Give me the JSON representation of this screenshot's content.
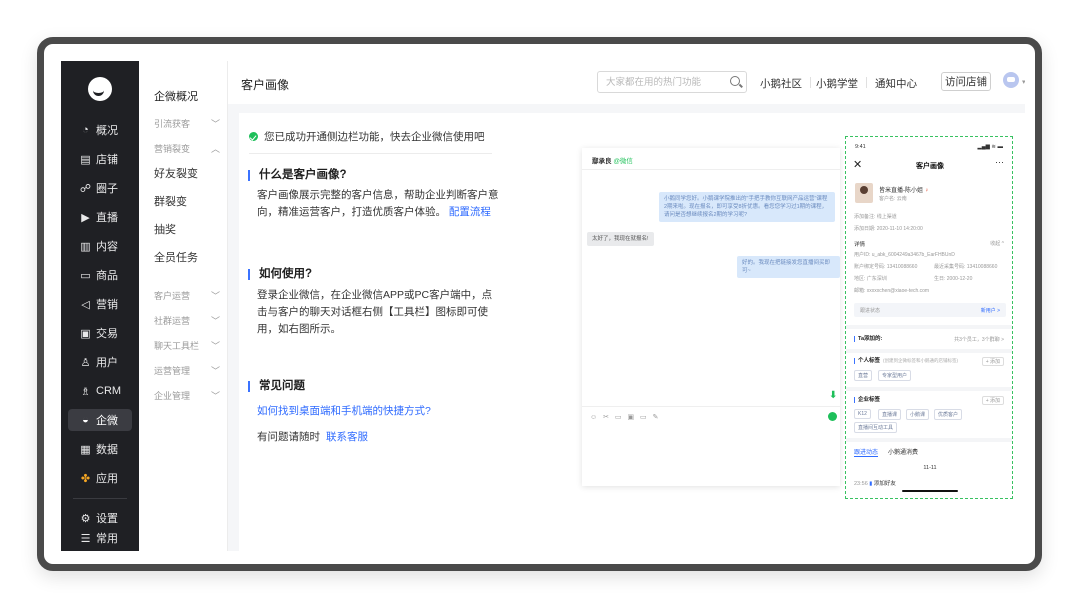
{
  "nav": {
    "items": [
      {
        "label": "概况",
        "icon": "clock-icon",
        "glyph": "◔"
      },
      {
        "label": "店铺",
        "icon": "store-icon",
        "glyph": "▤"
      },
      {
        "label": "圈子",
        "icon": "circle-group-icon",
        "glyph": "☍"
      },
      {
        "label": "直播",
        "icon": "live-icon",
        "glyph": "▶"
      },
      {
        "label": "内容",
        "icon": "document-icon",
        "glyph": "▥"
      },
      {
        "label": "商品",
        "icon": "product-icon",
        "glyph": "▭"
      },
      {
        "label": "营销",
        "icon": "marketing-icon",
        "glyph": "◁"
      },
      {
        "label": "交易",
        "icon": "trade-icon",
        "glyph": "▣"
      },
      {
        "label": "用户",
        "icon": "user-icon",
        "glyph": "♙"
      },
      {
        "label": "CRM",
        "icon": "crm-icon",
        "glyph": "♗"
      },
      {
        "label": "企微",
        "icon": "wecom-icon",
        "glyph": "◒"
      },
      {
        "label": "数据",
        "icon": "data-icon",
        "glyph": "▦"
      },
      {
        "label": "应用",
        "icon": "apps-icon",
        "glyph": "✤"
      },
      {
        "label": "设置",
        "icon": "gear-icon",
        "glyph": "⚙"
      },
      {
        "label": "常用",
        "icon": "list-icon",
        "glyph": "☰"
      }
    ]
  },
  "submenu": {
    "title": "企微概况",
    "groups": [
      "引流获客",
      "营销裂变",
      "客户运营",
      "社群运营",
      "聊天工具栏",
      "运营管理",
      "企业管理"
    ],
    "items": [
      "好友裂变",
      "群裂变",
      "抽奖",
      "全员任务"
    ]
  },
  "header": {
    "title": "客户画像",
    "search_placeholder": "大家都在用的热门功能",
    "links": [
      "小鹅社区",
      "小鹅学堂",
      "通知中心"
    ],
    "visit_store": "访问店铺"
  },
  "content": {
    "success_text": "您已成功开通侧边栏功能，快去企业微信使用吧",
    "section1_title": "什么是客户画像?",
    "section1_text": "客户画像展示完整的客户信息，帮助企业判断客户意向，精准运营客户，打造优质客户体验。",
    "section1_link": "配置流程",
    "section2_title": "如何使用?",
    "section2_text": "登录企业微信，在企业微信APP或PC客户端中，点击与客户的聊天对话框右侧【工具栏】图标即可使用，如右图所示。",
    "section3_title": "常见问题",
    "faq_link": "如何找到桌面端和手机端的快捷方式?",
    "help_text": "有问题请随时",
    "help_link": "联系客服"
  },
  "preview": {
    "chat_name": "鄢承良",
    "chat_tag": "@微信",
    "msg1": "小鹅同学您好。小鹅课学院推出的\"手把手教你互联网产品运营\"课程2期来啦。现在报名，即可享受8折优惠。看您您学习过1期的课程，请问是否想继续报名2期的学习呢?",
    "msg2": "太好了，我现在就报名!",
    "msg3": "好的。我现在把链接发您直播间买即可~",
    "tools": "☺ ✂ ▭ ▣ ▭ ✎",
    "panel": {
      "time": "9:41",
      "status": "▂▄▆ ≋ ▬",
      "title": "客户画像",
      "customer_name": "皆米直播-陈小姐",
      "customer_name_mark": "♀",
      "customer_sub": "客户名: 云南",
      "source": "添加备注: 线上渠道",
      "added": "添加日期: 2020-11-10 14:20:00",
      "detail_label": "详情",
      "detail_toggle": "收起 ^",
      "user_id": "用户ID: u_abk_6004249a3467b_EarFHBUnD",
      "phone1": "账户绑定号码: 13410088660",
      "phone2": "最近采集号码: 13410088660",
      "region": "地区: 广东深圳",
      "birthday": "生日: 2000-12-20",
      "email": "邮箱: xxxxxchen@xiaoe-tech.com",
      "follow_label": "跟进状态",
      "follow_value": "新用户 >",
      "added_by": "Ta添加的:",
      "added_by_right": "共3个员工，3个群聊 >",
      "personal_tags": "个人标签",
      "personal_tags_hint": "(创建到企微标签和小鹅通的店铺标签)",
      "add_label": "+ 添加",
      "personal_tag_list": [
        "直营",
        "专家型用户"
      ],
      "company_tags": "企业标签",
      "company_tag_list": [
        "K12",
        "直播课",
        "小鹅课",
        "优质客户",
        "直播间互动工具"
      ],
      "tab_active": "跟进动态",
      "tab_other": "小鹅通消费",
      "date": "11-11",
      "event_time": "23:56",
      "event": "添加好友"
    }
  }
}
